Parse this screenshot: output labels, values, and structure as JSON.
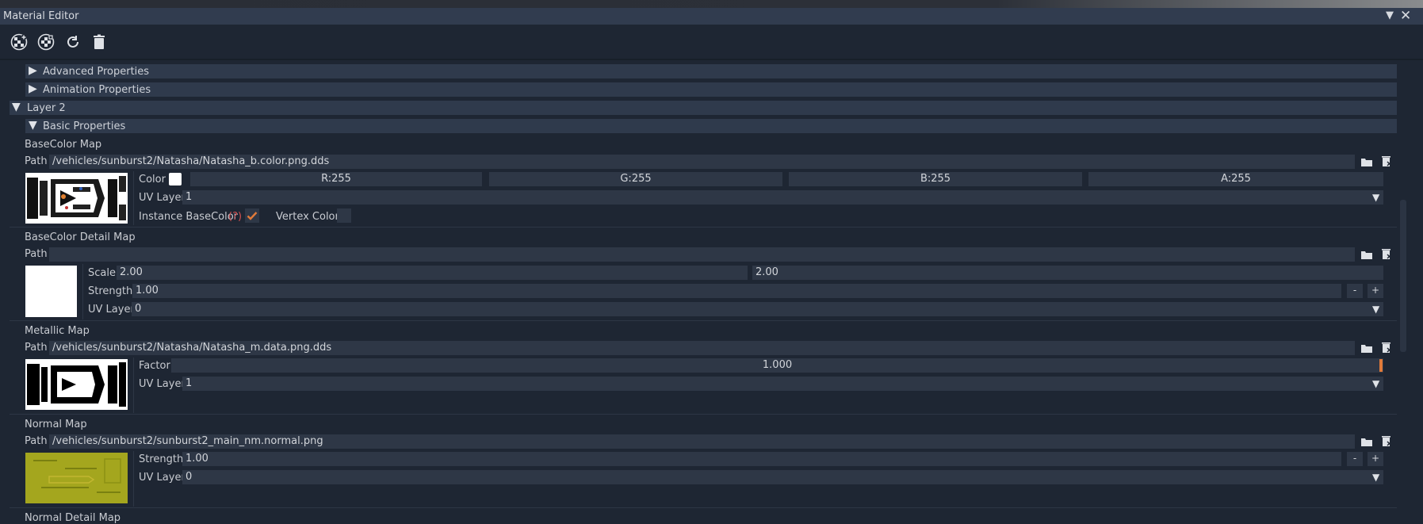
{
  "window": {
    "title": "Material Editor",
    "collapse_glyph": "▼",
    "close_glyph": "✕"
  },
  "toolbar": {
    "icons": [
      "add-material-icon",
      "copy-material-icon",
      "refresh-icon",
      "delete-icon"
    ]
  },
  "sections": {
    "advanced": "Advanced Properties",
    "animation": "Animation Properties",
    "layer2": "Layer 2",
    "basic": "Basic Properties"
  },
  "basecolor_map": {
    "title": "BaseColor Map",
    "path_label": "Path",
    "path": "/vehicles/sunburst2/Natasha/Natasha_b.color.png.dds",
    "color_label": "Color",
    "r": "R:255",
    "g": "G:255",
    "b": "B:255",
    "a": "A:255",
    "uv_label": "UV Layer",
    "uv_value": "1",
    "instance_label": "Instance BaseColor",
    "help": "(?)",
    "instance_checked": true,
    "vertex_label": "Vertex Color",
    "vertex_checked": false
  },
  "basecolor_detail_map": {
    "title": "BaseColor Detail Map",
    "path_label": "Path",
    "path": "",
    "scale_label": "Scale:",
    "scale_x": "2.00",
    "scale_y": "2.00",
    "strength_label": "Strength:",
    "strength": "1.00",
    "minus": "-",
    "plus": "+",
    "uv_label": "UV Layer",
    "uv_value": "0"
  },
  "metallic_map": {
    "title": "Metallic Map",
    "path_label": "Path",
    "path": "/vehicles/sunburst2/Natasha/Natasha_m.data.png.dds",
    "factor_label": "Factor",
    "factor": "1.000",
    "factor_fraction": 1.0,
    "uv_label": "UV Layer",
    "uv_value": "1"
  },
  "normal_map": {
    "title": "Normal Map",
    "path_label": "Path",
    "path": "/vehicles/sunburst2/sunburst2_main_nm.normal.png",
    "strength_label": "Strength",
    "strength": "1.00",
    "minus": "-",
    "plus": "+",
    "uv_label": "UV Layer",
    "uv_value": "0"
  },
  "normal_detail_map": {
    "title": "Normal Detail Map"
  },
  "colors": {
    "accent": "#e07a3a",
    "header_bg": "#2f3a4c",
    "field_bg": "#2e3746",
    "panel_bg": "#1e2633"
  }
}
